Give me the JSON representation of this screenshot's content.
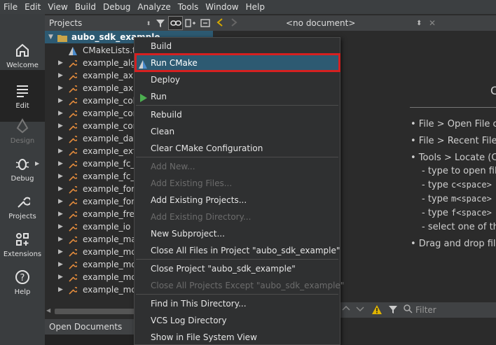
{
  "menubar": [
    "File",
    "Edit",
    "View",
    "Build",
    "Debug",
    "Analyze",
    "Tools",
    "Window",
    "Help"
  ],
  "modes": [
    {
      "label": "Welcome",
      "icon": "home-icon"
    },
    {
      "label": "Edit",
      "icon": "edit-icon"
    },
    {
      "label": "Design",
      "icon": "design-icon"
    },
    {
      "label": "Debug",
      "icon": "bug-icon"
    },
    {
      "label": "Projects",
      "icon": "wrench-icon"
    },
    {
      "label": "Extensions",
      "icon": "extensions-icon"
    },
    {
      "label": "Help",
      "icon": "help-icon"
    }
  ],
  "projects": {
    "title": "Projects",
    "root": "aubo_sdk_example",
    "cmakelists": "CMakeLists.txt",
    "items": [
      "example_algo",
      "example_axis",
      "example_axis",
      "example_coll",
      "example_con",
      "example_con",
      "example_data",
      "example_extr",
      "example_fc_a",
      "example_fc_a",
      "example_forc",
      "example_forc",
      "example_free",
      "example_io",
      "example_mat",
      "example_mov",
      "example_mov",
      "example_mov",
      "example_mov"
    ]
  },
  "open_documents": "Open Documents",
  "editor": {
    "document": "<no document>",
    "heading": "C",
    "tips": [
      "• File > Open File o",
      "• File > Recent Files",
      "• Tools > Locate (Ct"
    ],
    "subtips": [
      {
        "pre": "- type to open fil",
        "mono": ""
      },
      {
        "pre": "- type ",
        "mono": "c<space>"
      },
      {
        "pre": "- type ",
        "mono": "m<space>"
      },
      {
        "pre": "- type ",
        "mono": "f<space>"
      },
      {
        "pre": "- select one of th",
        "mono": ""
      }
    ],
    "drag_tip": "• Drag and drop file"
  },
  "output": {
    "filter_placeholder": "Filter"
  },
  "context_menu": {
    "items": [
      {
        "label": "Build",
        "disabled": false
      },
      {
        "label": "Run CMake",
        "disabled": false,
        "highlighted": true,
        "icon": "cmake-icon"
      },
      {
        "label": "Deploy",
        "disabled": false
      },
      {
        "label": "Run",
        "disabled": false,
        "icon": "run-icon"
      },
      {
        "label": "Rebuild",
        "disabled": false
      },
      {
        "label": "Clean",
        "disabled": false
      },
      {
        "label": "Clear CMake Configuration",
        "disabled": false
      },
      {
        "label": "Add New...",
        "disabled": true
      },
      {
        "label": "Add Existing Files...",
        "disabled": true
      },
      {
        "label": "Add Existing Projects...",
        "disabled": false
      },
      {
        "label": "Add Existing Directory...",
        "disabled": true
      },
      {
        "label": "New Subproject...",
        "disabled": false
      },
      {
        "label": "Close All Files in Project \"aubo_sdk_example\"",
        "disabled": false
      },
      {
        "label": "Close Project \"aubo_sdk_example\"",
        "disabled": false
      },
      {
        "label": "Close All Projects Except \"aubo_sdk_example\"",
        "disabled": true
      },
      {
        "label": "Find in This Directory...",
        "disabled": false
      },
      {
        "label": "VCS Log Directory",
        "disabled": false
      },
      {
        "label": "Show in File System View",
        "disabled": false
      }
    ]
  },
  "colors": {
    "selection": "#2d5a72",
    "annotation_box": "#d62020",
    "run_green": "#4caf50"
  }
}
